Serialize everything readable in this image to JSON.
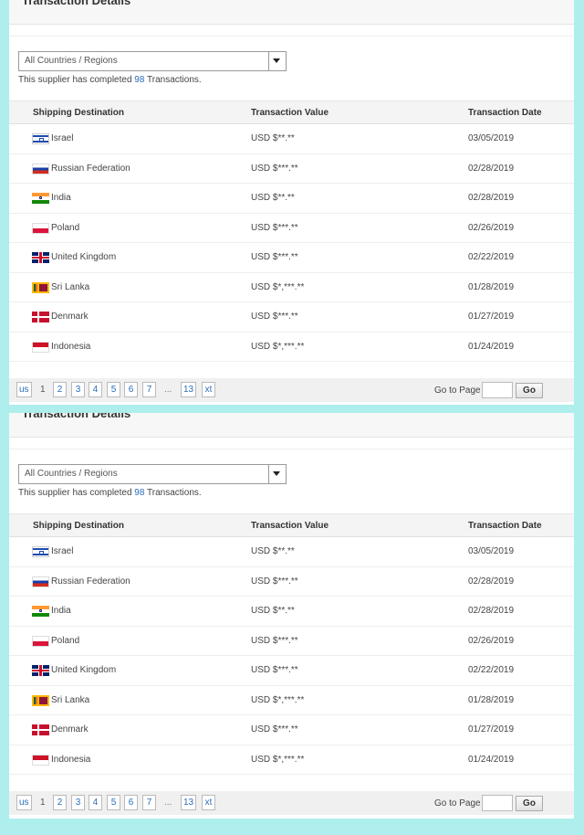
{
  "panels": [
    {
      "title": "Transaction Details",
      "filter": {
        "selected": "All Countries / Regions"
      },
      "summary": {
        "prefix": "This supplier has completed ",
        "count": "98",
        "suffix": " Transactions."
      },
      "headers": {
        "destination": "Shipping Destination",
        "value": "Transaction Value",
        "date": "Transaction Date"
      },
      "rows": [
        {
          "country": "Israel",
          "flag": "il",
          "value": "USD $**.**",
          "date": "03/05/2019"
        },
        {
          "country": "Russian Federation",
          "flag": "ru",
          "value": "USD $***.**",
          "date": "02/28/2019"
        },
        {
          "country": "India",
          "flag": "in",
          "value": "USD $**.**",
          "date": "02/28/2019"
        },
        {
          "country": "Poland",
          "flag": "pl",
          "value": "USD $***.**",
          "date": "02/26/2019"
        },
        {
          "country": "United Kingdom",
          "flag": "gb",
          "value": "USD $***.**",
          "date": "02/22/2019"
        },
        {
          "country": "Sri Lanka",
          "flag": "lk",
          "value": "USD $*,***.**",
          "date": "01/28/2019"
        },
        {
          "country": "Denmark",
          "flag": "dk",
          "value": "USD $***.**",
          "date": "01/27/2019"
        },
        {
          "country": "Indonesia",
          "flag": "id",
          "value": "USD $*,***.**",
          "date": "01/24/2019"
        }
      ],
      "pager": {
        "prev": "us",
        "current": "1",
        "pages": [
          "2",
          "3",
          "4",
          "5",
          "6",
          "7"
        ],
        "dots": "...",
        "last": "13",
        "next": "xt",
        "goto_label": "Go to Page",
        "go": "Go"
      }
    },
    {
      "title": "Transaction Details",
      "filter": {
        "selected": "All Countries / Regions"
      },
      "summary": {
        "prefix": "This supplier has completed ",
        "count": "98",
        "suffix": " Transactions."
      },
      "headers": {
        "destination": "Shipping Destination",
        "value": "Transaction Value",
        "date": "Transaction Date"
      },
      "rows": [
        {
          "country": "Israel",
          "flag": "il",
          "value": "USD $**.**",
          "date": "03/05/2019"
        },
        {
          "country": "Russian Federation",
          "flag": "ru",
          "value": "USD $***.**",
          "date": "02/28/2019"
        },
        {
          "country": "India",
          "flag": "in",
          "value": "USD $**.**",
          "date": "02/28/2019"
        },
        {
          "country": "Poland",
          "flag": "pl",
          "value": "USD $***.**",
          "date": "02/26/2019"
        },
        {
          "country": "United Kingdom",
          "flag": "gb",
          "value": "USD $***.**",
          "date": "02/22/2019"
        },
        {
          "country": "Sri Lanka",
          "flag": "lk",
          "value": "USD $*,***.**",
          "date": "01/28/2019"
        },
        {
          "country": "Denmark",
          "flag": "dk",
          "value": "USD $***.**",
          "date": "01/27/2019"
        },
        {
          "country": "Indonesia",
          "flag": "id",
          "value": "USD $*,***.**",
          "date": "01/24/2019"
        }
      ],
      "pager": {
        "prev": "us",
        "current": "1",
        "pages": [
          "2",
          "3",
          "4",
          "5",
          "6",
          "7"
        ],
        "dots": "...",
        "last": "13",
        "next": "xt",
        "goto_label": "Go to Page",
        "go": "Go"
      }
    }
  ]
}
